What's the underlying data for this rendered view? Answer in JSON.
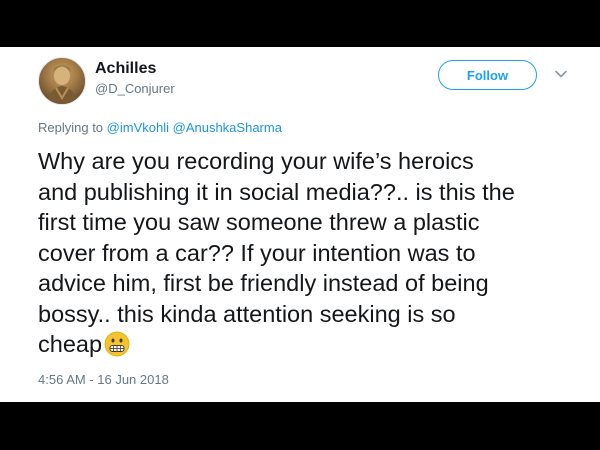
{
  "user": {
    "name": "Achilles",
    "handle": "@D_Conjurer"
  },
  "follow_label": "Follow",
  "reply": {
    "prefix": "Replying to",
    "mentions": [
      "@imVkohli",
      "@AnushkaSharma"
    ]
  },
  "tweet": {
    "lines": [
      "Why are you recording your wife’s heroics",
      "and publishing it in social media??.. is this the",
      "first time you saw someone threw a plastic",
      "cover from a car?? If your intention was to",
      "advice him, first be friendly instead of being",
      "bossy.. this kinda attention seeking is so",
      "cheap"
    ],
    "emoji": "grimacing-face-icon"
  },
  "timestamp": "4:56 AM - 16 Jun 2018",
  "colors": {
    "accent": "#1da1f2",
    "mention": "#1b95e0",
    "secondary_text": "#657786",
    "primary_text": "#14171a"
  }
}
